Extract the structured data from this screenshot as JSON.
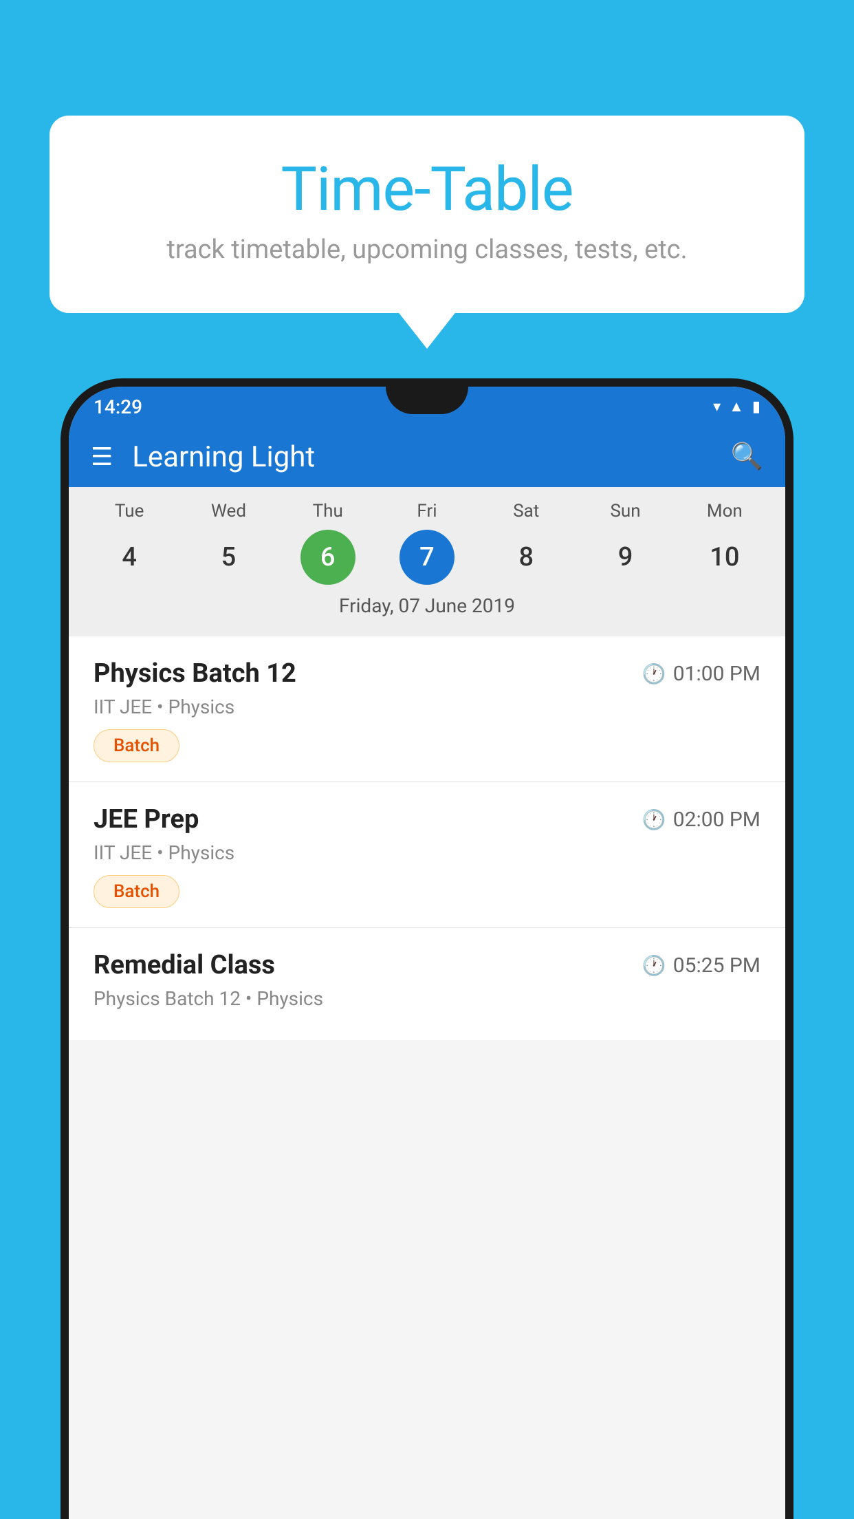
{
  "background_color": "#29b6e8",
  "bubble": {
    "title": "Time-Table",
    "subtitle": "track timetable, upcoming classes, tests, etc."
  },
  "phone": {
    "status_bar": {
      "time": "14:29",
      "icons": [
        "wifi",
        "signal",
        "battery"
      ]
    },
    "app_header": {
      "title": "Learning Light",
      "menu_icon": "☰",
      "search_icon": "🔍"
    },
    "calendar": {
      "days": [
        {
          "label": "Tue",
          "num": "4"
        },
        {
          "label": "Wed",
          "num": "5"
        },
        {
          "label": "Thu",
          "num": "6",
          "state": "today"
        },
        {
          "label": "Fri",
          "num": "7",
          "state": "selected"
        },
        {
          "label": "Sat",
          "num": "8"
        },
        {
          "label": "Sun",
          "num": "9"
        },
        {
          "label": "Mon",
          "num": "10"
        }
      ],
      "selected_date": "Friday, 07 June 2019"
    },
    "schedule": [
      {
        "name": "Physics Batch 12",
        "time": "01:00 PM",
        "meta": "IIT JEE • Physics",
        "badge": "Batch"
      },
      {
        "name": "JEE Prep",
        "time": "02:00 PM",
        "meta": "IIT JEE • Physics",
        "badge": "Batch"
      },
      {
        "name": "Remedial Class",
        "time": "05:25 PM",
        "meta": "Physics Batch 12 • Physics",
        "badge": null
      }
    ]
  }
}
